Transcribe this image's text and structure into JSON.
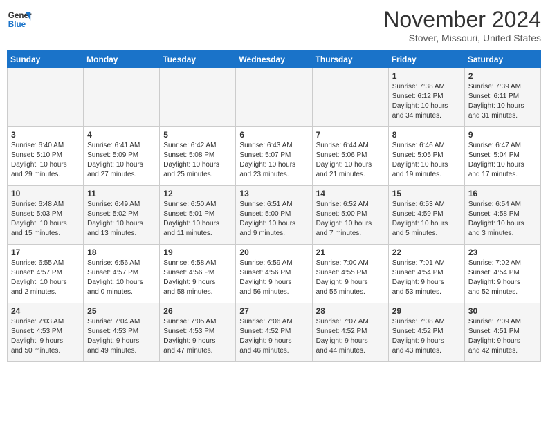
{
  "header": {
    "logo_line1": "General",
    "logo_line2": "Blue",
    "month_title": "November 2024",
    "location": "Stover, Missouri, United States"
  },
  "weekdays": [
    "Sunday",
    "Monday",
    "Tuesday",
    "Wednesday",
    "Thursday",
    "Friday",
    "Saturday"
  ],
  "weeks": [
    [
      {
        "day": "",
        "info": ""
      },
      {
        "day": "",
        "info": ""
      },
      {
        "day": "",
        "info": ""
      },
      {
        "day": "",
        "info": ""
      },
      {
        "day": "",
        "info": ""
      },
      {
        "day": "1",
        "info": "Sunrise: 7:38 AM\nSunset: 6:12 PM\nDaylight: 10 hours\nand 34 minutes."
      },
      {
        "day": "2",
        "info": "Sunrise: 7:39 AM\nSunset: 6:11 PM\nDaylight: 10 hours\nand 31 minutes."
      }
    ],
    [
      {
        "day": "3",
        "info": "Sunrise: 6:40 AM\nSunset: 5:10 PM\nDaylight: 10 hours\nand 29 minutes."
      },
      {
        "day": "4",
        "info": "Sunrise: 6:41 AM\nSunset: 5:09 PM\nDaylight: 10 hours\nand 27 minutes."
      },
      {
        "day": "5",
        "info": "Sunrise: 6:42 AM\nSunset: 5:08 PM\nDaylight: 10 hours\nand 25 minutes."
      },
      {
        "day": "6",
        "info": "Sunrise: 6:43 AM\nSunset: 5:07 PM\nDaylight: 10 hours\nand 23 minutes."
      },
      {
        "day": "7",
        "info": "Sunrise: 6:44 AM\nSunset: 5:06 PM\nDaylight: 10 hours\nand 21 minutes."
      },
      {
        "day": "8",
        "info": "Sunrise: 6:46 AM\nSunset: 5:05 PM\nDaylight: 10 hours\nand 19 minutes."
      },
      {
        "day": "9",
        "info": "Sunrise: 6:47 AM\nSunset: 5:04 PM\nDaylight: 10 hours\nand 17 minutes."
      }
    ],
    [
      {
        "day": "10",
        "info": "Sunrise: 6:48 AM\nSunset: 5:03 PM\nDaylight: 10 hours\nand 15 minutes."
      },
      {
        "day": "11",
        "info": "Sunrise: 6:49 AM\nSunset: 5:02 PM\nDaylight: 10 hours\nand 13 minutes."
      },
      {
        "day": "12",
        "info": "Sunrise: 6:50 AM\nSunset: 5:01 PM\nDaylight: 10 hours\nand 11 minutes."
      },
      {
        "day": "13",
        "info": "Sunrise: 6:51 AM\nSunset: 5:00 PM\nDaylight: 10 hours\nand 9 minutes."
      },
      {
        "day": "14",
        "info": "Sunrise: 6:52 AM\nSunset: 5:00 PM\nDaylight: 10 hours\nand 7 minutes."
      },
      {
        "day": "15",
        "info": "Sunrise: 6:53 AM\nSunset: 4:59 PM\nDaylight: 10 hours\nand 5 minutes."
      },
      {
        "day": "16",
        "info": "Sunrise: 6:54 AM\nSunset: 4:58 PM\nDaylight: 10 hours\nand 3 minutes."
      }
    ],
    [
      {
        "day": "17",
        "info": "Sunrise: 6:55 AM\nSunset: 4:57 PM\nDaylight: 10 hours\nand 2 minutes."
      },
      {
        "day": "18",
        "info": "Sunrise: 6:56 AM\nSunset: 4:57 PM\nDaylight: 10 hours\nand 0 minutes."
      },
      {
        "day": "19",
        "info": "Sunrise: 6:58 AM\nSunset: 4:56 PM\nDaylight: 9 hours\nand 58 minutes."
      },
      {
        "day": "20",
        "info": "Sunrise: 6:59 AM\nSunset: 4:56 PM\nDaylight: 9 hours\nand 56 minutes."
      },
      {
        "day": "21",
        "info": "Sunrise: 7:00 AM\nSunset: 4:55 PM\nDaylight: 9 hours\nand 55 minutes."
      },
      {
        "day": "22",
        "info": "Sunrise: 7:01 AM\nSunset: 4:54 PM\nDaylight: 9 hours\nand 53 minutes."
      },
      {
        "day": "23",
        "info": "Sunrise: 7:02 AM\nSunset: 4:54 PM\nDaylight: 9 hours\nand 52 minutes."
      }
    ],
    [
      {
        "day": "24",
        "info": "Sunrise: 7:03 AM\nSunset: 4:53 PM\nDaylight: 9 hours\nand 50 minutes."
      },
      {
        "day": "25",
        "info": "Sunrise: 7:04 AM\nSunset: 4:53 PM\nDaylight: 9 hours\nand 49 minutes."
      },
      {
        "day": "26",
        "info": "Sunrise: 7:05 AM\nSunset: 4:53 PM\nDaylight: 9 hours\nand 47 minutes."
      },
      {
        "day": "27",
        "info": "Sunrise: 7:06 AM\nSunset: 4:52 PM\nDaylight: 9 hours\nand 46 minutes."
      },
      {
        "day": "28",
        "info": "Sunrise: 7:07 AM\nSunset: 4:52 PM\nDaylight: 9 hours\nand 44 minutes."
      },
      {
        "day": "29",
        "info": "Sunrise: 7:08 AM\nSunset: 4:52 PM\nDaylight: 9 hours\nand 43 minutes."
      },
      {
        "day": "30",
        "info": "Sunrise: 7:09 AM\nSunset: 4:51 PM\nDaylight: 9 hours\nand 42 minutes."
      }
    ]
  ]
}
